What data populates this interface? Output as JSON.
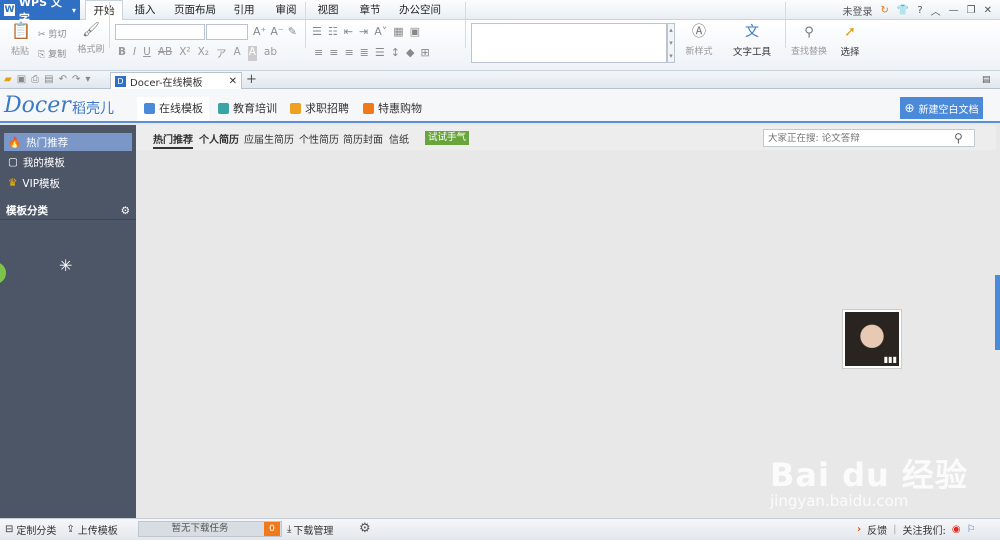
{
  "app": {
    "name": "WPS 文字"
  },
  "menu": {
    "items": [
      "开始",
      "插入",
      "页面布局",
      "引用",
      "审阅",
      "视图",
      "章节",
      "办公空间"
    ],
    "right": {
      "login": "未登录",
      "help": "?"
    }
  },
  "ribbon": {
    "clipboard": {
      "paste": "粘贴",
      "cut": "剪切",
      "copy": "复制",
      "format_painter": "格式刷"
    },
    "styles": {
      "new_style": "新样式"
    },
    "text_tools": {
      "label": "文字工具"
    },
    "find_replace": {
      "label": "查找替换"
    },
    "select": {
      "label": "选择"
    }
  },
  "tabs": {
    "doc_tab": "Docer-在线模板",
    "add": "+"
  },
  "docer": {
    "logo": "Docer",
    "logo_cn": "稻壳儿",
    "tabs": [
      "在线模板",
      "教育培训",
      "求职招聘",
      "特惠购物"
    ],
    "new_doc": "新建空白文档"
  },
  "sidebar": {
    "items": [
      "热门推荐",
      "我的模板",
      "VIP模板"
    ],
    "category_header": "模板分类"
  },
  "subnav": {
    "items": [
      "热门推荐",
      "个人简历",
      "应届生简历",
      "个性简历",
      "简历封面",
      "信纸"
    ],
    "try_button": "试试手气"
  },
  "search": {
    "placeholder": "大家正在搜: 论文答辩"
  },
  "watermark": {
    "text": "Bai du 经验",
    "url": "jingyan.baidu.com"
  },
  "statusbar": {
    "custom_category": "定制分类",
    "upload": "上传模板",
    "download_status": "暂无下载任务",
    "download_count": "0",
    "download_manager": "下载管理",
    "feedback": "反馈",
    "follow": "关注我们:"
  },
  "colors": {
    "accent": "#4a8ad8",
    "sidebar": "#4d5666",
    "active_item": "#7a97c7",
    "try_green": "#6aa53c",
    "badge_orange": "#f07a1b"
  }
}
